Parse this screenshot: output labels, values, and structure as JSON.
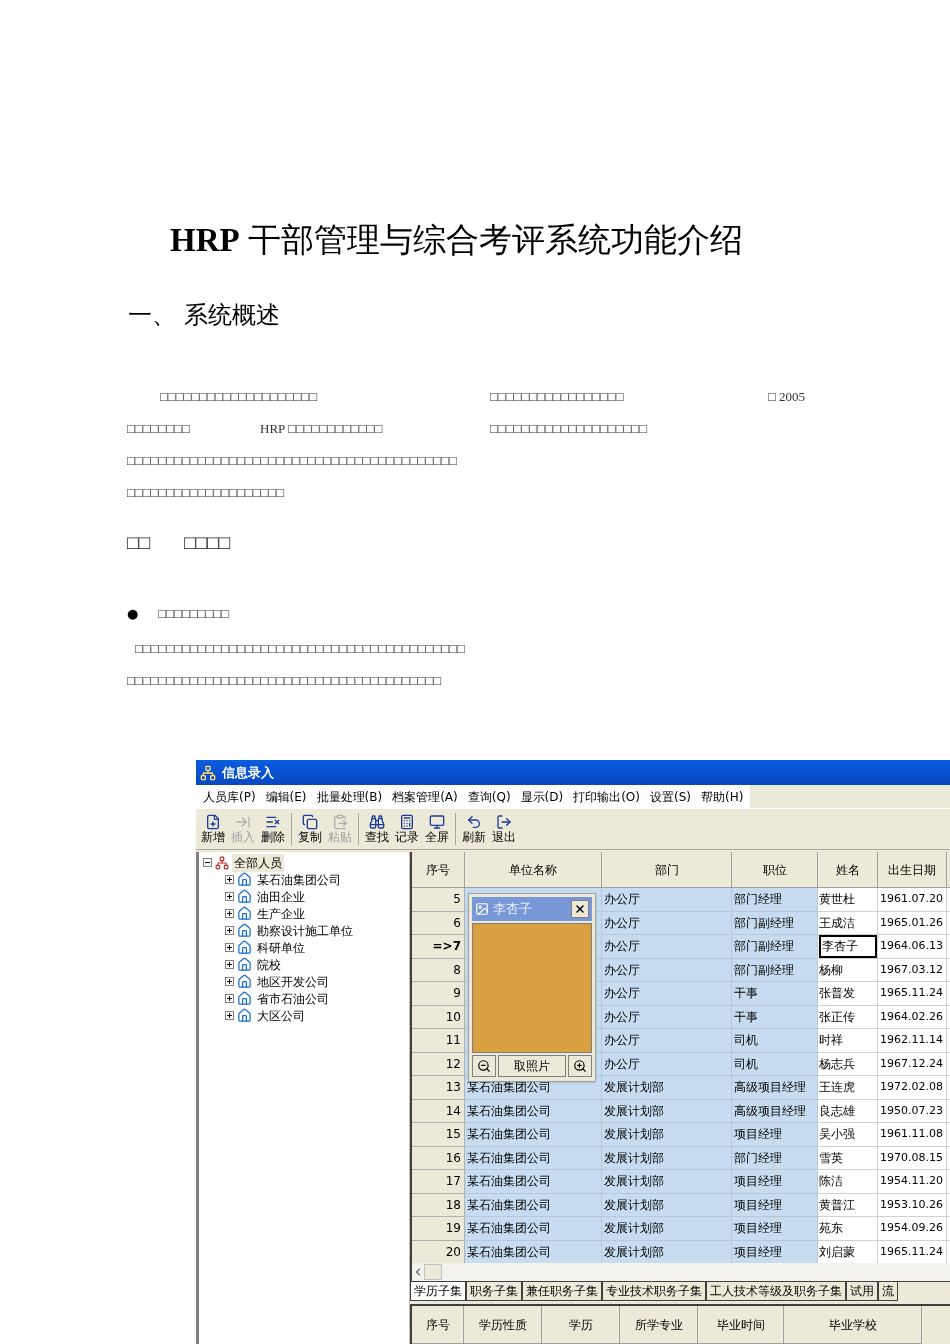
{
  "document": {
    "title": "**HRP** 干部管理与综合考评系统功能介绍",
    "section_heading": "一、 系统概述",
    "paragraph_lines": [
      [
        "□□□□□□□□□□□□□□□□□□□□",
        "□□□□□□□□□□□□□□□□□",
        "□ 2005"
      ],
      [
        "□□□□□□□□",
        "HRP □□□□□□□□□□□□",
        "□□□□□□□□□□□□□□□□□□□□"
      ],
      [
        "□□□□□□□□□□□□□□□□□□□□□□□□□□□□□□□□□□□□□□□□□□"
      ],
      [
        "□□□□□□□□□□□□□□□□□□□□"
      ]
    ],
    "subheading": [
      "□□",
      "□□□□"
    ],
    "bullet": {
      "symbol": "●",
      "text": "□□□□□□□□□"
    },
    "bullet_lines": [
      "□□□□□□□□□□□□□□□□□□□□□□□□□□□□□□□□□□□□□□□□□□",
      "□□□□□□□□□□□□□□□□□□□□□□□□□□□□□□□□□□□□□□□□"
    ]
  },
  "app": {
    "title": "信息录入",
    "menu": [
      "人员库(P)",
      "编辑(E)",
      "批量处理(B)",
      "档案管理(A)",
      "查询(Q)",
      "显示(D)",
      "打印输出(O)",
      "设置(S)",
      "帮助(H)"
    ],
    "toolbar": [
      {
        "label": "新增",
        "kind": "new",
        "disabled": false
      },
      {
        "label": "插入",
        "kind": "insert",
        "disabled": true
      },
      {
        "label": "删除",
        "kind": "delete",
        "disabled": false
      },
      {
        "label": "复制",
        "kind": "copy",
        "disabled": false
      },
      {
        "label": "粘贴",
        "kind": "paste",
        "disabled": true
      },
      {
        "label": "查找",
        "kind": "find",
        "disabled": false
      },
      {
        "label": "记录",
        "kind": "record",
        "disabled": false
      },
      {
        "label": "全屏",
        "kind": "fullscreen",
        "disabled": false
      },
      {
        "label": "刷新",
        "kind": "refresh",
        "disabled": false
      },
      {
        "label": "退出",
        "kind": "exit",
        "disabled": false
      }
    ],
    "tree": {
      "label": "全部人员",
      "expanded": true,
      "selected": true,
      "children": [
        {
          "label": "某石油集团公司",
          "expanded": false,
          "selected": false
        },
        {
          "label": "油田企业",
          "expanded": false,
          "selected": false
        },
        {
          "label": "生产企业",
          "expanded": false,
          "selected": false
        },
        {
          "label": "勘察设计施工单位",
          "expanded": false,
          "selected": false
        },
        {
          "label": "科研单位",
          "expanded": false,
          "selected": false
        },
        {
          "label": "院校",
          "expanded": false,
          "selected": false
        },
        {
          "label": "地区开发公司",
          "expanded": false,
          "selected": false
        },
        {
          "label": "省市石油公司",
          "expanded": false,
          "selected": false
        },
        {
          "label": "大区公司",
          "expanded": false,
          "selected": false
        }
      ]
    },
    "grid": {
      "columns": [
        "序号",
        "单位名称",
        "部门",
        "职位",
        "姓名",
        "出生日期"
      ],
      "rows": [
        {
          "seq": "5",
          "dept": "办公厅",
          "position": "部门经理",
          "name": "黄世杜",
          "birth": "1961.07.20",
          "selected": false
        },
        {
          "seq": "6",
          "dept": "办公厅",
          "position": "部门副经理",
          "name": "王成洁",
          "birth": "1965.01.26",
          "selected": false
        },
        {
          "seq": "=>7",
          "dept": "办公厅",
          "position": "部门副经理",
          "name": "李杏子",
          "birth": "1964.06.13",
          "selected": true
        },
        {
          "seq": "8",
          "dept": "办公厅",
          "position": "部门副经理",
          "name": "杨柳",
          "birth": "1967.03.12",
          "selected": false
        },
        {
          "seq": "9",
          "dept": "办公厅",
          "position": "干事",
          "name": "张普发",
          "birth": "1965.11.24",
          "selected": false
        },
        {
          "seq": "10",
          "dept": "办公厅",
          "position": "干事",
          "name": "张正传",
          "birth": "1964.02.26",
          "selected": false
        },
        {
          "seq": "11",
          "dept": "办公厅",
          "position": "司机",
          "name": "时祥",
          "birth": "1962.11.14",
          "selected": false
        },
        {
          "seq": "12",
          "dept": "办公厅",
          "position": "司机",
          "name": "杨志兵",
          "birth": "1967.12.24",
          "selected": false
        },
        {
          "seq": "13",
          "unit": "某石油集团公司",
          "dept": "发展计划部",
          "position": "高级项目经理",
          "name": "王连虎",
          "birth": "1972.02.08",
          "selected": false
        },
        {
          "seq": "14",
          "unit": "某石油集团公司",
          "dept": "发展计划部",
          "position": "高级项目经理",
          "name": "良志雄",
          "birth": "1950.07.23",
          "selected": false
        },
        {
          "seq": "15",
          "unit": "某石油集团公司",
          "dept": "发展计划部",
          "position": "项目经理",
          "name": "吴小强",
          "birth": "1961.11.08",
          "selected": false
        },
        {
          "seq": "16",
          "unit": "某石油集团公司",
          "dept": "发展计划部",
          "position": "部门经理",
          "name": "雪英",
          "birth": "1970.08.15",
          "selected": false
        },
        {
          "seq": "17",
          "unit": "某石油集团公司",
          "dept": "发展计划部",
          "position": "项目经理",
          "name": "陈洁",
          "birth": "1954.11.20",
          "selected": false
        },
        {
          "seq": "18",
          "unit": "某石油集团公司",
          "dept": "发展计划部",
          "position": "项目经理",
          "name": "黄普江",
          "birth": "1953.10.26",
          "selected": false
        },
        {
          "seq": "19",
          "unit": "某石油集团公司",
          "dept": "发展计划部",
          "position": "项目经理",
          "name": "苑东",
          "birth": "1954.09.26",
          "selected": false
        },
        {
          "seq": "20",
          "unit": "某石油集团公司",
          "dept": "发展计划部",
          "position": "项目经理",
          "name": "刘启蒙",
          "birth": "1965.11.24",
          "selected": false
        }
      ]
    },
    "photo_popup": {
      "title": "李杏子",
      "button": "取照片"
    },
    "tabs": [
      {
        "label": "学历子集",
        "selected": true
      },
      {
        "label": "职务子集",
        "selected": false
      },
      {
        "label": "兼任职务子集",
        "selected": false
      },
      {
        "label": "专业技术职务子集",
        "selected": false
      },
      {
        "label": "工人技术等级及职务子集",
        "selected": false
      },
      {
        "label": "试用",
        "selected": false
      },
      {
        "label": "流",
        "selected": false
      }
    ],
    "sub_grid": {
      "columns": [
        "序号",
        "学历性质",
        "学历",
        "所学专业",
        "毕业时间",
        "毕业学校"
      ]
    }
  }
}
